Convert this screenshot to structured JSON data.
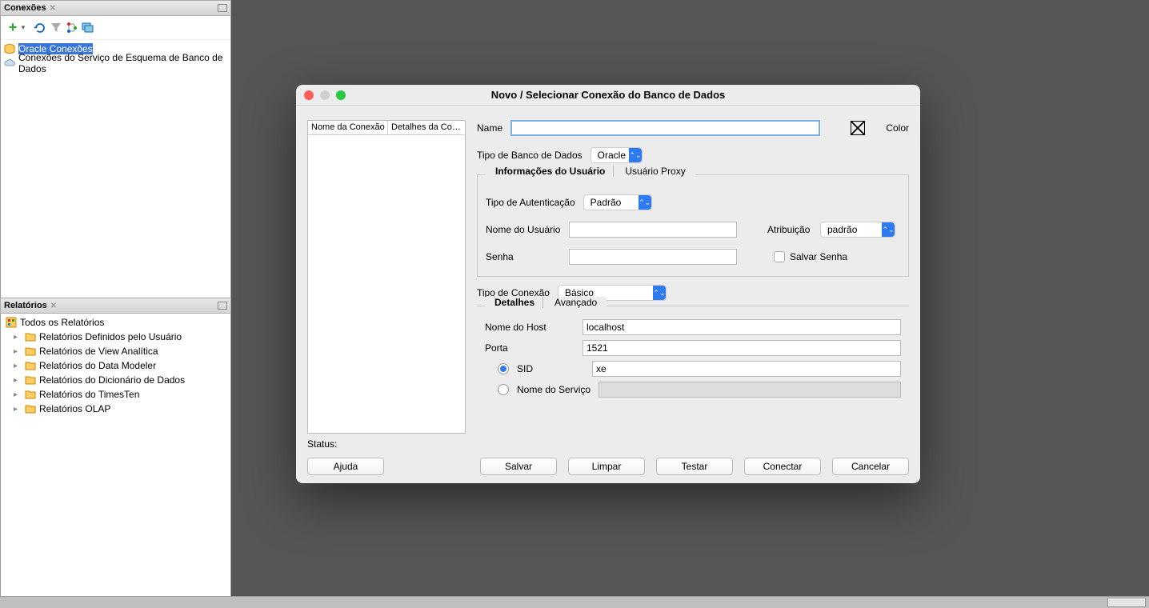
{
  "sidebar": {
    "connections": {
      "title": "Conexões",
      "items": [
        {
          "label": "Oracle Conexões",
          "selected": true
        },
        {
          "label": "Conexões do Serviço de Esquema de Banco de Dados",
          "selected": false
        }
      ]
    },
    "reports": {
      "title": "Relatórios",
      "root": "Todos os Relatórios",
      "items": [
        "Relatórios Definidos pelo Usuário",
        "Relatórios de View Analítica",
        "Relatórios do Data Modeler",
        "Relatórios do Dicionário de Dados",
        "Relatórios do TimesTen",
        "Relatórios OLAP"
      ]
    }
  },
  "dialog": {
    "title": "Novo / Selecionar Conexão do Banco de Dados",
    "columns": {
      "name": "Nome da Conexão",
      "details": "Detalhes da Con..."
    },
    "name_label": "Name",
    "name_value": "",
    "color_label": "Color",
    "db_type_label": "Tipo de Banco de Dados",
    "db_type_value": "Oracle",
    "tabs_user": {
      "info": "Informações do Usuário",
      "proxy": "Usuário Proxy"
    },
    "auth_type_label": "Tipo de Autenticação",
    "auth_type_value": "Padrão",
    "username_label": "Nome do Usuário",
    "username_value": "",
    "attribution_label": "Atribuição",
    "attribution_value": "padrão",
    "password_label": "Senha",
    "password_value": "",
    "save_password_label": "Salvar Senha",
    "conn_type_label": "Tipo de Conexão",
    "conn_type_value": "Básico",
    "tabs_conn": {
      "details": "Detalhes",
      "advanced": "Avançado"
    },
    "host_label": "Nome do Host",
    "host_value": "localhost",
    "port_label": "Porta",
    "port_value": "1521",
    "sid_label": "SID",
    "sid_value": "xe",
    "service_label": "Nome do Serviço",
    "service_value": "",
    "status_label": "Status:",
    "buttons": {
      "help": "Ajuda",
      "save": "Salvar",
      "clear": "Limpar",
      "test": "Testar",
      "connect": "Conectar",
      "cancel": "Cancelar"
    }
  }
}
